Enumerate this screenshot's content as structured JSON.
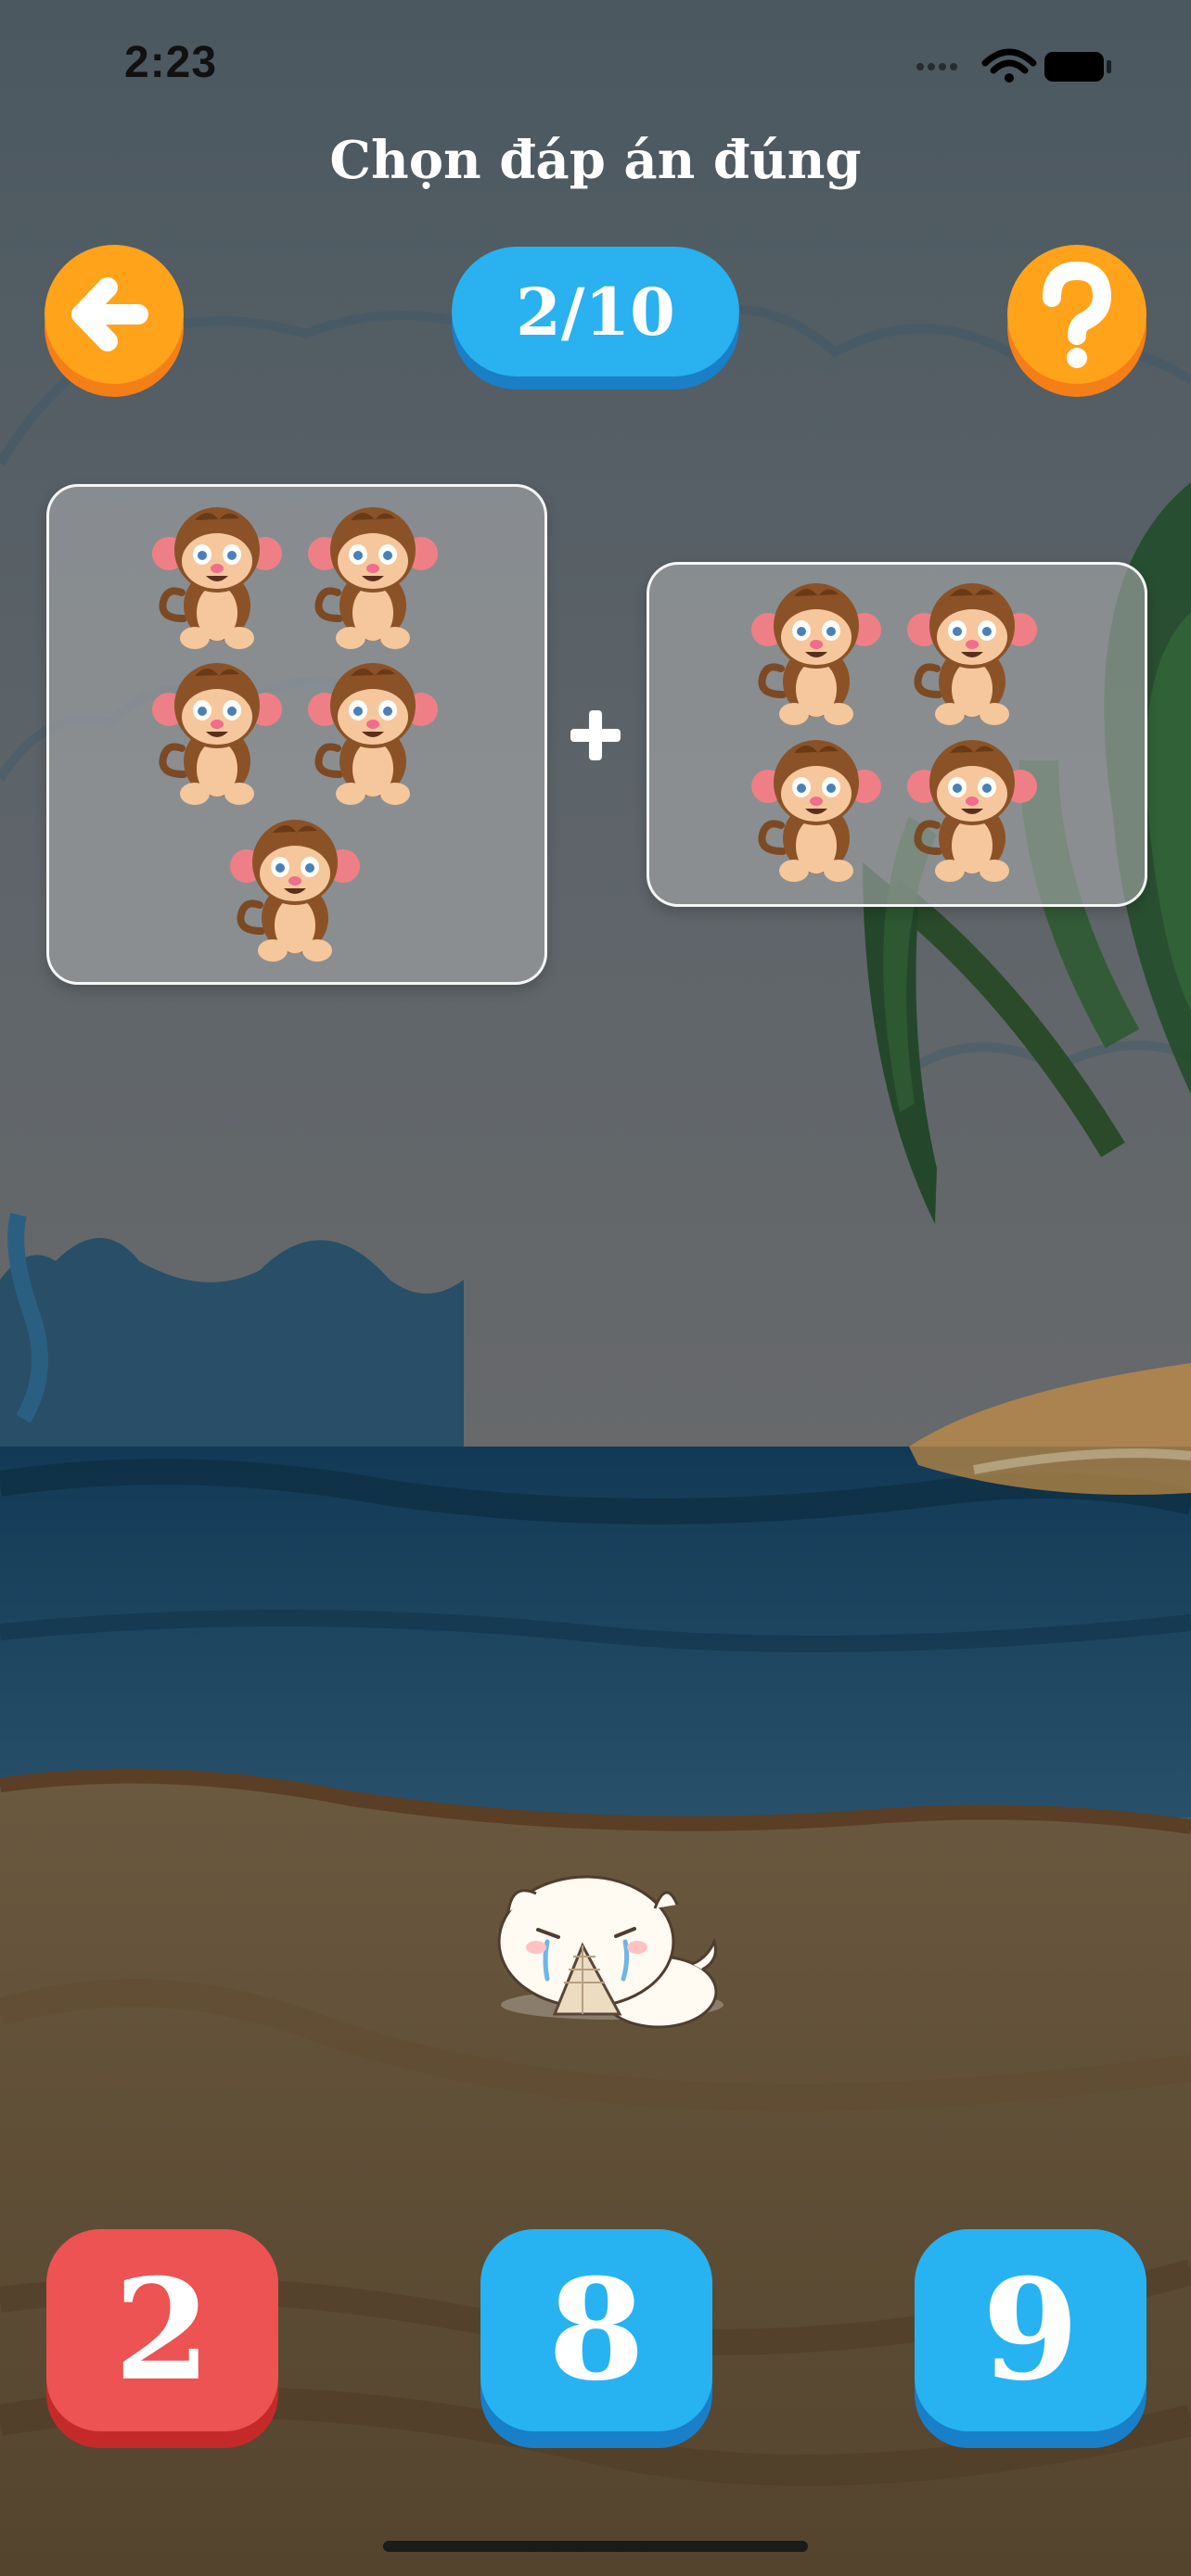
{
  "status_bar": {
    "time": "2:23"
  },
  "header": {
    "title": "Chọn đáp án đúng",
    "progress": "2/10",
    "back_icon": "arrow-left-icon",
    "help_icon": "question-mark-icon"
  },
  "question": {
    "left_group_count": 5,
    "right_group_count": 4,
    "operator": "+",
    "operator_icon": "plus-icon",
    "item_icon": "monkey-icon"
  },
  "answers": [
    {
      "label": "2",
      "state": "wrong"
    },
    {
      "label": "8",
      "state": "default"
    },
    {
      "label": "9",
      "state": "default"
    }
  ],
  "colors": {
    "orange": "#ffa31a",
    "blue": "#29b1f0",
    "red": "#ec5352"
  },
  "feedback": {
    "character_icon": "crying-cat-icon"
  }
}
